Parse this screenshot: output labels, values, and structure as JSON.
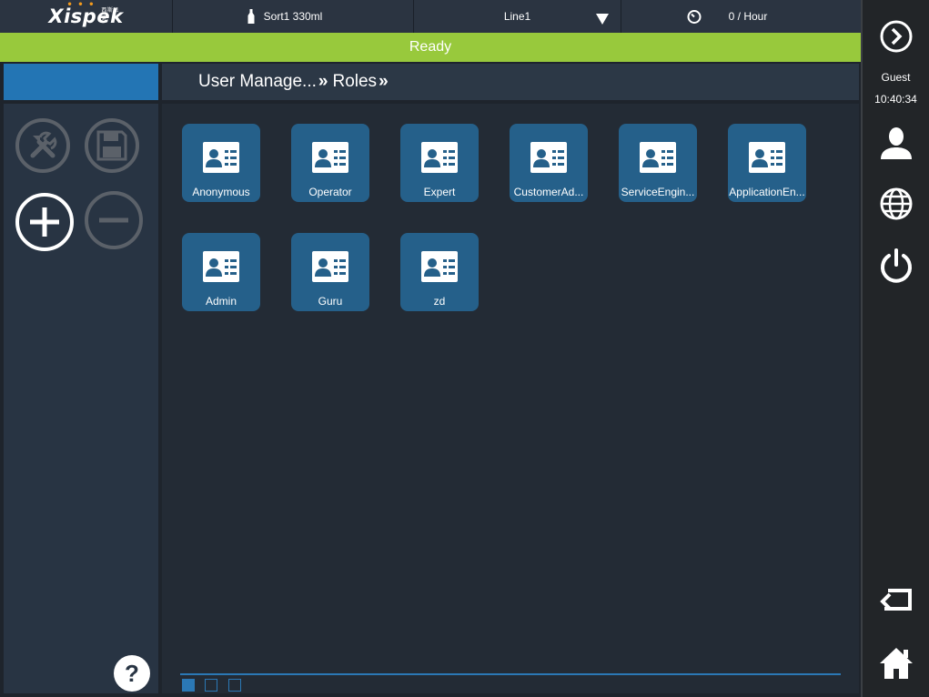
{
  "header": {
    "brand": "Xispek",
    "brand_cn": "西斯派克",
    "product": "Sort1 330ml",
    "line": "Line1",
    "rate": "0 / Hour"
  },
  "status": "Ready",
  "breadcrumb": {
    "items": [
      "User Manage...",
      "Roles"
    ],
    "separator": "»"
  },
  "roles": [
    {
      "label": "Anonymous"
    },
    {
      "label": "Operator"
    },
    {
      "label": "Expert"
    },
    {
      "label": "CustomerAd..."
    },
    {
      "label": "ServiceEngin..."
    },
    {
      "label": "ApplicationEn..."
    },
    {
      "label": "Admin"
    },
    {
      "label": "Guru"
    },
    {
      "label": "zd"
    }
  ],
  "sidebar_right": {
    "user": "Guest",
    "time": "10:40:34"
  },
  "help_label": "?",
  "pager": {
    "pages": 3,
    "current": 1
  },
  "colors": {
    "accent": "#2375b4",
    "status": "#98c93c",
    "tile": "#25608a"
  }
}
